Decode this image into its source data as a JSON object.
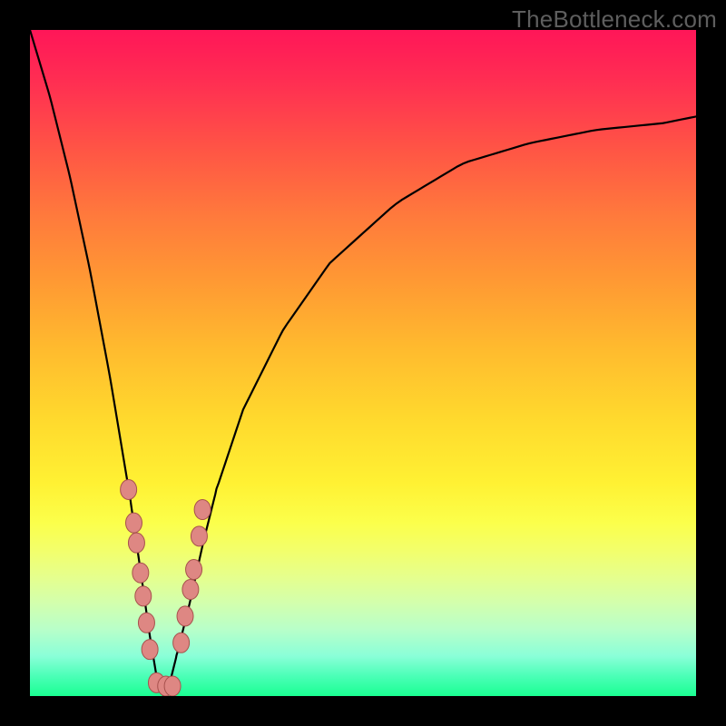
{
  "watermark": "TheBottleneck.com",
  "colors": {
    "frame": "#000000",
    "curve": "#000000",
    "marker_fill": "#de8783",
    "marker_stroke": "#a7514d"
  },
  "chart_data": {
    "type": "line",
    "title": "",
    "xlabel": "",
    "ylabel": "",
    "xlim": [
      0,
      100
    ],
    "ylim": [
      0,
      100
    ],
    "note": "V-shaped bottleneck curve. y values estimated from vertical position (0=bottom/green, 100=top/red). Minimum (0) around x≈20.",
    "series": [
      {
        "name": "bottleneck-curve",
        "x": [
          0,
          3,
          6,
          9,
          12,
          15,
          17,
          18,
          19,
          20,
          21,
          22,
          24,
          26,
          28,
          32,
          38,
          45,
          55,
          65,
          75,
          85,
          95,
          100
        ],
        "y": [
          100,
          90,
          78,
          64,
          48,
          30,
          16,
          9,
          3,
          0,
          2,
          6,
          14,
          23,
          31,
          43,
          55,
          65,
          74,
          80,
          83,
          85,
          86,
          87
        ]
      }
    ],
    "markers": {
      "name": "highlighted-points",
      "note": "Pink dots clustered near the valley on both branches.",
      "x": [
        14.8,
        15.6,
        16.0,
        16.6,
        17.0,
        17.5,
        18.0,
        19.0,
        20.4,
        21.4,
        22.7,
        23.3,
        24.1,
        24.6,
        25.4,
        25.9
      ],
      "y": [
        31.0,
        26.0,
        23.0,
        18.5,
        15.0,
        11.0,
        7.0,
        2.0,
        1.5,
        1.5,
        8.0,
        12.0,
        16.0,
        19.0,
        24.0,
        28.0
      ]
    }
  }
}
